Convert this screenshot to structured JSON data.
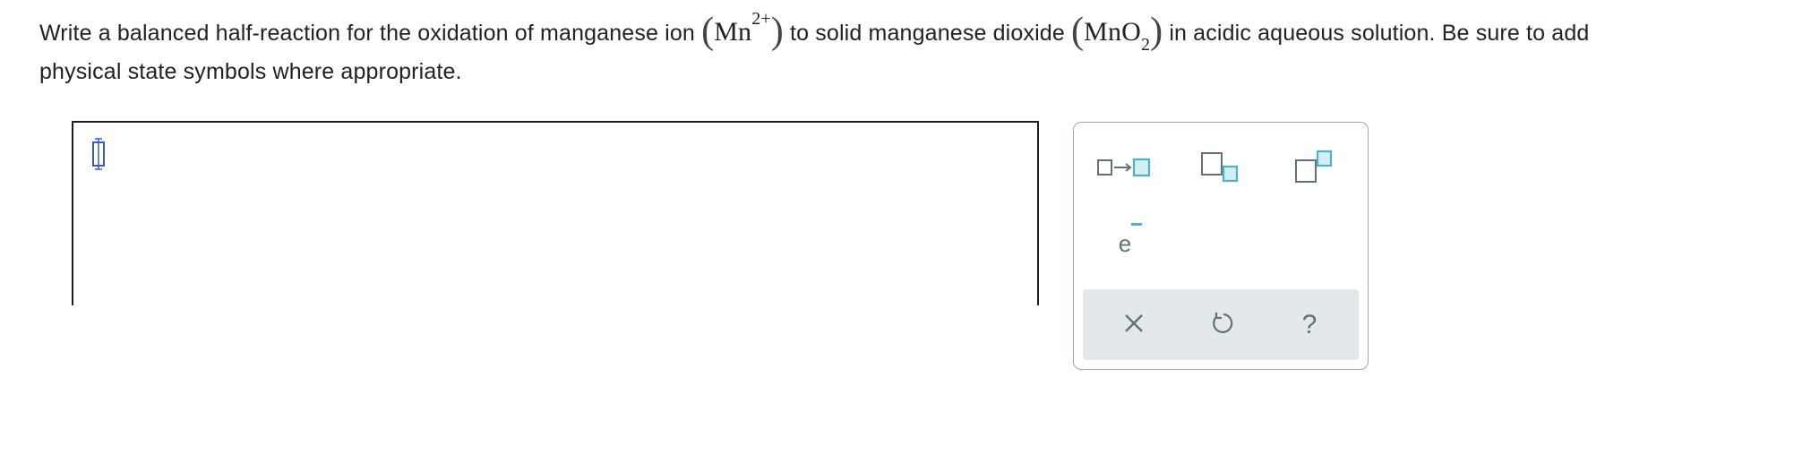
{
  "question": {
    "part1": "Write a balanced half-reaction for the oxidation of manganese ion ",
    "ion_symbol": "Mn",
    "ion_charge": "2+",
    "part2": " to solid manganese dioxide ",
    "product_symbol": "MnO",
    "product_subscript": "2",
    "part3": " in acidic aqueous solution. Be sure to add",
    "line2": "physical state symbols where appropriate."
  },
  "palette": {
    "tools": [
      {
        "name": "reaction-arrow-tool",
        "icon": "box-arrow-box-icon"
      },
      {
        "name": "subscript-tool",
        "icon": "subscript-box-icon"
      },
      {
        "name": "superscript-tool",
        "icon": "superscript-box-icon"
      },
      {
        "name": "electron-tool",
        "icon": "electron-icon",
        "label": "e"
      }
    ],
    "actions": [
      {
        "name": "clear-button",
        "icon": "x-icon"
      },
      {
        "name": "undo-button",
        "icon": "undo-icon"
      },
      {
        "name": "help-button",
        "icon": "question-icon",
        "label": "?"
      }
    ]
  },
  "colors": {
    "accent": "#4bb3c7",
    "icon_gray": "#62727a",
    "cursor_blue": "#3a5bd0",
    "action_bar_bg": "#e3e8eb"
  }
}
